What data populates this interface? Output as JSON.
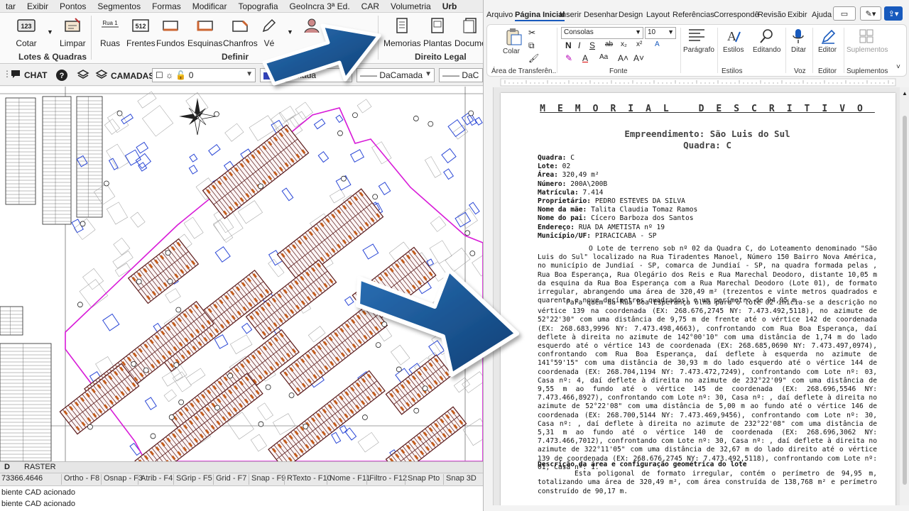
{
  "cad": {
    "menu": [
      "tar",
      "Exibir",
      "Pontos",
      "Segmentos",
      "Formas",
      "Modificar",
      "Topografia",
      "GeoIncra 3ª Ed.",
      "CAR",
      "Volumetria",
      "Urb"
    ],
    "ribbon": {
      "buttons": {
        "cotar": "Cotar",
        "limpar": "Limpar",
        "ruas": "Ruas",
        "frentes": "Frentes",
        "fundos": "Fundos",
        "esquinas": "Esquinas",
        "chanfros": "Chanfros",
        "vertices": "Vé",
        "memorias": "Memorias",
        "plantas": "Plantas",
        "documentos": "Docume"
      },
      "icon_text": {
        "cotar": "123",
        "ruas": "Rua 1",
        "frentes": "512"
      },
      "groups": {
        "lotes_quadras": "Lotes & Quadras",
        "definir": "Definir",
        "direito_legal": "Direito Legal"
      }
    },
    "toolbar": {
      "chat": "CHAT",
      "camadas": "CAMADAS",
      "layer_value": "0",
      "color_value": "DaCamada",
      "linetype_value": "DaCamada",
      "lineweight_value": "DaC"
    },
    "tabs": [
      "D",
      "RASTER"
    ],
    "status": {
      "coordinate": "73366.4646",
      "toggles": [
        "Ortho - F8",
        "Osnap - F3",
        "Atrib - F4",
        "SGrip - F5",
        "Grid - F7",
        "Snap - F9",
        "RTexto - F10",
        "Nome - F11",
        "Filtro - F12",
        "Snap Pto",
        "Snap 3D"
      ]
    },
    "command_lines": [
      "biente CAD acionado",
      "biente CAD acionado"
    ]
  },
  "word": {
    "tabs": [
      "Arquivo",
      "Página Inicial",
      "Inserir",
      "Desenhar",
      "Design",
      "Layout",
      "Referências",
      "Correspondê",
      "Revisão",
      "Exibir",
      "Ajuda"
    ],
    "ribbon": {
      "paste": "Colar",
      "font_name": "Consolas",
      "font_size": "10",
      "paragraph": "Parágrafo",
      "styles": "Estilos",
      "editing": "Editando",
      "dictate": "Ditar",
      "editor": "Editor",
      "addins": "Suplementos",
      "groups": {
        "clipboard": "Área de Transferên...",
        "font": "Fonte",
        "styles": "Estilos",
        "voice": "Voz",
        "editor": "Editor",
        "addins": "Suplementos"
      }
    },
    "document": {
      "title": "MEMORIAL DESCRITIVO",
      "subtitle1": "Empreendimento: São Luis do Sul",
      "subtitle2": "Quadra: C",
      "fields": [
        {
          "label": "Quadra:",
          "value": "C"
        },
        {
          "label": "Lote:",
          "value": "02"
        },
        {
          "label": "Área:",
          "value": "320,49 m²"
        },
        {
          "label": "Número:",
          "value": "200A\\200B"
        },
        {
          "label": "Matrícula:",
          "value": "7.414"
        },
        {
          "label": "Proprietário:",
          "value": "PEDRO ESTEVES DA SILVA"
        },
        {
          "label": "Nome da mãe:",
          "value": "Talita Claudia Tomaz Ramos"
        },
        {
          "label": "Nome do pai:",
          "value": "Cícero Barboza dos Santos"
        },
        {
          "label": "Endereço:",
          "value": "RUA DA AMETISTA nº 19"
        },
        {
          "label": "Município/UF:",
          "value": "PIRACICABA - SP"
        }
      ],
      "paragraph1": "O Lote de terreno sob nº 02 da Quadra C, do Loteamento denominado \"São Luis do Sul\" localizado na Rua Tiradentes Manoel, Número 150 Bairro Nova América, no município de Jundiaí - SP, comarca de Jundiaí - SP, na quadra formada pelas , Rua Boa Esperança, Rua Olegário dos Reis e Rua Marechal Deodoro, distante 10,05 m da esquina da Rua Boa Esperança com a Rua Marechal Deodoro (Lote 01), de formato irregular, abrangendo uma área de 320,49 m² (trezentos e vinte metros quadrados e quarenta e nove decímetros quadrados) e um perímetro de 94,95 m.",
      "paragraph2": "Para quem da Rua Boa Esperança olha para o lote 02 inicia-se a descrição no vértice 139 na coordenada (EX: 268.676,2745 NY: 7.473.492,5118), no azimute de 52°22'30\" com uma distância de 9,75 m de frente até o vértice 142 de coordenada (EX: 268.683,9996 NY: 7.473.498,4663), confrontando com Rua Boa Esperança, daí deflete à direita no azimute de 142°00'10\" com uma distância de 1,74 m do lado esquerdo até o vértice 143 de coordenada (EX: 268.685,0690 NY: 7.473.497,0974), confrontando com Rua Boa Esperança, daí deflete à esquerda no azimute de 141°59'15\" com uma distância de 30,93 m do lado esquerdo até o vértice 144 de coordenada (EX: 268.704,1194 NY: 7.473.472,7249), confrontando com Lote nº: 03, Casa nº: 4, daí deflete à direita no azimute de 232°22'09\" com uma distância de 9,55 m ao fundo até o vértice 145 de coordenada (EX: 268.696,5546 NY: 7.473.466,8927), confrontando com Lote nº: 30, Casa nº: , daí deflete à direita no azimute de 52°22'08\" com uma distância de 5,00 m ao fundo até o vértice 146 de coordenada (EX: 268.700,5144 NY: 7.473.469,9456), confrontando com Lote nº: 30, Casa nº: , daí deflete à direita no azimute de 232°22'08\" com uma distância de 5,31 m ao fundo até o vértice 140 de coordenada (EX: 268.696,3062 NY: 7.473.466,7012), confrontando com Lote nº: 30, Casa nº: , daí deflete à direita no azimute de 322°11'05\" com uma distância de 32,67 m do lado direito até o vértice 139 de coordenada (EX: 268.676,2745 NY: 7.473.492,5118), confrontando com Lote nº: 01, Casa nº: 1.",
      "section_heading": "Descrição da área e configuração geométrica do lote",
      "paragraph3": "Esta poligonal de formato irregular, contém o perímetro de 94,95 m, totalizando uma área de 320,49 m², com área construída de 138,768 m² e perímetro construído de 90,17 m."
    }
  },
  "colors": {
    "arrow": "#174f8c",
    "parcel_outline": "#d81bd8",
    "building": "#2a47d6",
    "lot_lines": "#5a1a1a",
    "word_accent": "#185abd"
  }
}
